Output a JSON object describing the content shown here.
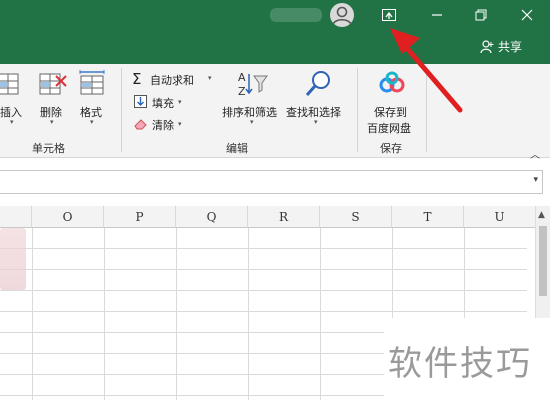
{
  "titlebar": {
    "share_label": "共享",
    "icons": [
      "user-avatar-icon",
      "ribbon-display-options-icon",
      "minimize-icon",
      "restore-icon",
      "close-icon"
    ]
  },
  "ribbon": {
    "cells_group": {
      "label": "单元格",
      "insert": "插入",
      "delete": "删除",
      "format": "格式"
    },
    "editing_group": {
      "label": "编辑",
      "autosum": "自动求和",
      "fill": "填充",
      "clear": "清除",
      "sort_filter": "排序和筛选",
      "find_select": "查找和选择"
    },
    "save_group": {
      "label": "保存",
      "save_line1": "保存到",
      "save_line2": "百度网盘"
    }
  },
  "grid": {
    "columns": [
      "O",
      "P",
      "Q",
      "R",
      "S",
      "T",
      "U"
    ]
  },
  "watermark": "软件技巧",
  "colors": {
    "title_green": "#217346",
    "annotation_red": "#e02020"
  }
}
